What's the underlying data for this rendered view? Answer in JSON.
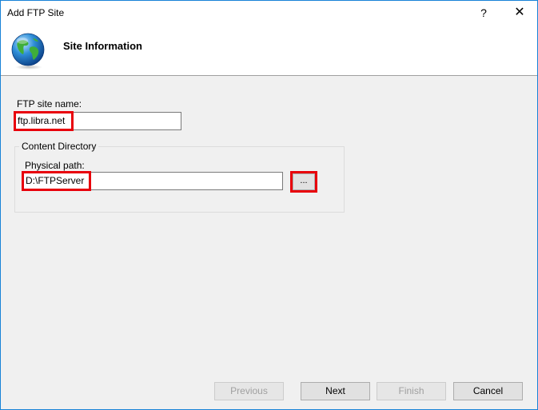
{
  "window": {
    "title": "Add FTP Site",
    "help_glyph": "?",
    "close_glyph": "✕"
  },
  "header": {
    "title": "Site Information",
    "icon": "globe-icon"
  },
  "form": {
    "site_name_label": "FTP site name:",
    "site_name_value": "ftp.libra.net",
    "content_directory_label": "Content Directory",
    "physical_path_label": "Physical path:",
    "physical_path_value": "D:\\FTPServer",
    "browse_label": "..."
  },
  "footer": {
    "previous_label": "Previous",
    "next_label": "Next",
    "finish_label": "Finish",
    "cancel_label": "Cancel"
  },
  "colors": {
    "highlight": "#e8000b",
    "window_border": "#1883d7"
  }
}
